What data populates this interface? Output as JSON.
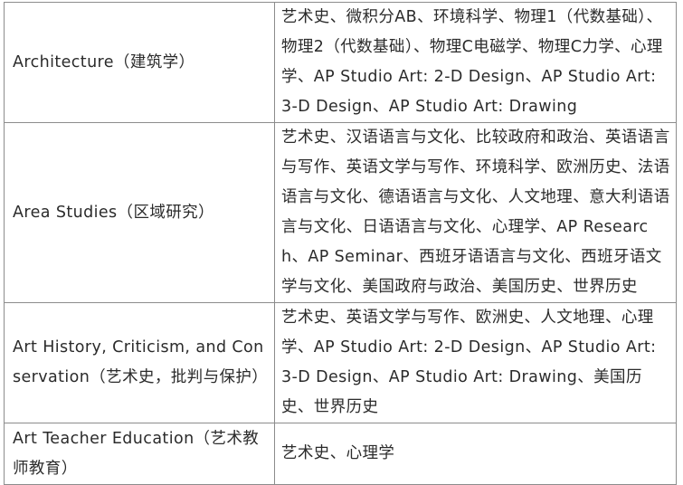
{
  "rows": [
    {
      "major": "Architecture（建筑学）",
      "courses": "艺术史、微积分AB、环境科学、物理1（代数基础）、物理2（代数基础）、物理C电磁学、物理C力学、心理学、AP Studio Art: 2-D Design、AP Studio Art: 3-D Design、AP Studio Art: Drawing"
    },
    {
      "major": "Area Studies（区域研究）",
      "courses": "艺术史、汉语语言与文化、比较政府和政治、英语语言与写作、英语文学与写作、环境科学、欧洲历史、法语语言与文化、德语语言与文化、人文地理、意大利语语言与文化、日语语言与文化、心理学、AP Research、AP Seminar、西班牙语语言与文化、西班牙语文学与文化、美国政府与政治、美国历史、世界历史"
    },
    {
      "major": "Art History, Criticism, and Conservation（艺术史，批判与保护）",
      "courses": "艺术史、英语文学与写作、欧洲史、人文地理、心理学、AP Studio Art: 2-D Design、AP Studio Art: 3-D Design、AP Studio Art: Drawing、美国历史、世界历史"
    },
    {
      "major": "Art Teacher Education（艺术教师教育）",
      "courses": "艺术史、心理学"
    }
  ]
}
